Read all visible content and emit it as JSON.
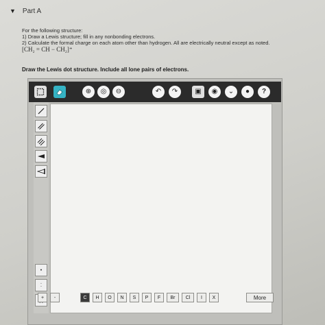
{
  "header": {
    "caret": "▼",
    "part_label": "Part A"
  },
  "question": {
    "intro": "For the following structure:",
    "step1": "1) Draw a Lewis structure; fill in any nonbonding electrons.",
    "step2": "2) Calculate the formal charge on each atom other than hydrogen. All are electrically neutral except as noted.",
    "formula": "[CH₂ = CH − CH₂]⁺"
  },
  "instruction": "Draw the Lewis dot structure. Include all lone pairs of electrons.",
  "toolbar": {
    "select_icon": "lasso-select-icon",
    "eraser_icon": "eraser-icon",
    "zoom_in_label": "⊕",
    "zoom_reset_label": "◎",
    "zoom_out_label": "⊖",
    "undo_label": "↶",
    "redo_label": "↷",
    "copy_label": "▣",
    "tips_label": "◉",
    "expand_label": "⌄",
    "info_label": "●",
    "help_label": "?"
  },
  "left_tools": {
    "single_bond": "single-bond-icon",
    "double_bond": "double-bond-icon",
    "triple_bond": "triple-bond-icon",
    "wedge_bond": "wedge-bond-icon",
    "dash_bond": "hash-bond-icon",
    "lone_pair": "•",
    "radical": "⁚",
    "bracket": "[ ]"
  },
  "atoms": {
    "plus": "+",
    "minus": "-",
    "elements": [
      "C",
      "H",
      "O",
      "N",
      "S",
      "P",
      "F",
      "Br",
      "Cl",
      "I",
      "X"
    ],
    "more_label": "More"
  }
}
